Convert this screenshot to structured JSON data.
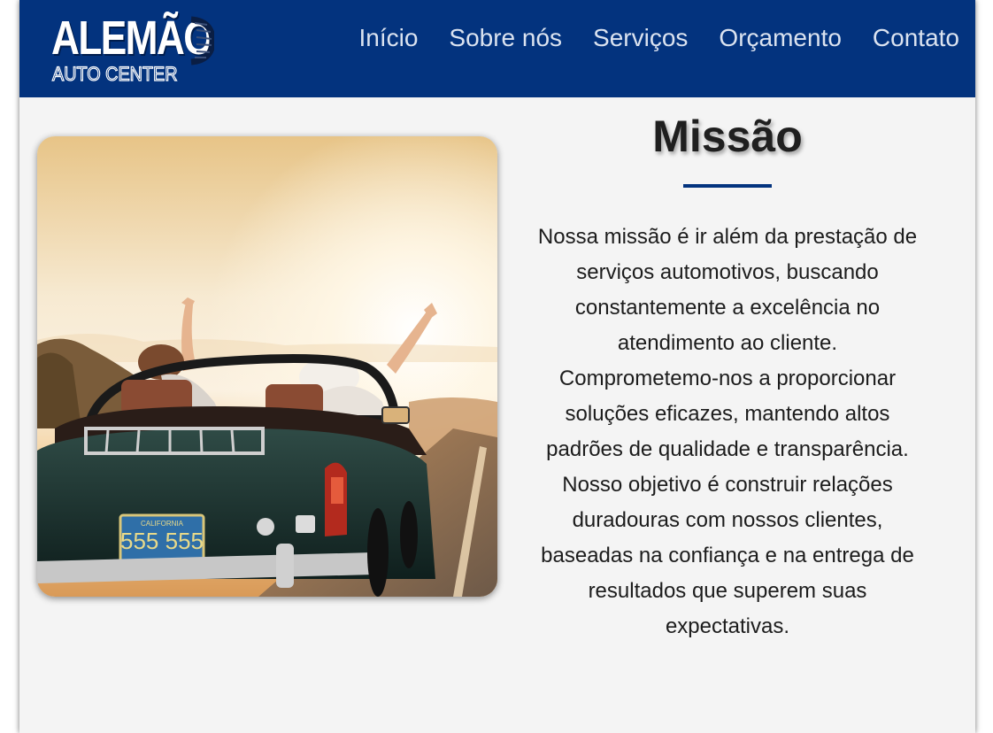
{
  "brand": {
    "logo_main": "ALEMÃO",
    "logo_sub": "AUTO CENTER",
    "primary_color": "#03337e"
  },
  "nav": {
    "items": [
      {
        "label": "Início"
      },
      {
        "label": "Sobre nós"
      },
      {
        "label": "Serviços"
      },
      {
        "label": "Orçamento"
      },
      {
        "label": "Contato"
      }
    ]
  },
  "hero_image": {
    "description_icon": "convertible-car-photo",
    "plate_text": "555 555",
    "plate_state": "CALIFORNIA"
  },
  "mission": {
    "title": "Missão",
    "text": "Nossa missão é ir além da prestação de serviços automotivos, buscando constantemente a excelência no atendimento ao cliente. Comprometemo-nos a proporcionar soluções eficazes, mantendo altos padrões de qualidade e transparência. Nosso objetivo é construir relações duradouras com nossos clientes, baseadas na confiança e na entrega de resultados que superem suas expectativas."
  }
}
